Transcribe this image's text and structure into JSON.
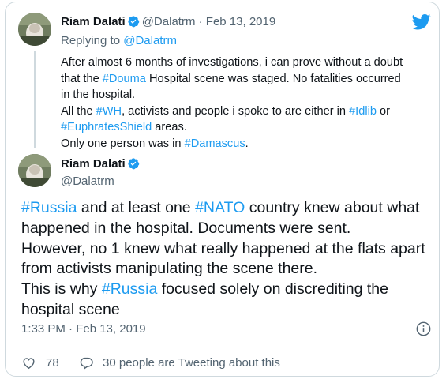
{
  "colors": {
    "accent": "#1d9bf0",
    "muted": "#536471",
    "border": "#cfd9de"
  },
  "parent_tweet": {
    "name": "Riam Dalati",
    "handle": "@Dalatrm",
    "separator": "·",
    "date": "Feb 13, 2019",
    "replying_prefix": "Replying to",
    "replying_to": "@Dalatrm",
    "lines": {
      "l1": "After almost 6 months of investigations, i can prove without a doubt",
      "l2a": "that the",
      "l2tag": "#Douma",
      "l2b": "Hospital scene was staged. No fatalities occurred",
      "l3": "in the hospital.",
      "l4a": "All the",
      "l4tag1": "#WH",
      "l4b": ", activists and people i spoke to are either in",
      "l4tag2": "#Idlib",
      "l4c": "or",
      "l5tag": "#EuphratesShield",
      "l5b": "areas.",
      "l6a": "Only one person was in",
      "l6tag": "#Damascus",
      "l6b": "."
    }
  },
  "main_tweet": {
    "name": "Riam Dalati",
    "handle": "@Dalatrm",
    "lines": {
      "l1tag1": "#Russia",
      "l1a": "and at least one",
      "l1tag2": "#NATO",
      "l1b": "country knew about what",
      "l2": "happened in the hospital. Documents were sent.",
      "l3": "However, no 1 knew what really happened at the flats apart",
      "l4": "from activists manipulating the scene there.",
      "l5a": "This is why",
      "l5tag": "#Russia",
      "l5b": "focused solely on discrediting the",
      "l6": "hospital scene"
    },
    "timestamp": "1:33 PM · Feb 13, 2019",
    "like_count": "78",
    "conversation_text": "30 people are Tweeting about this"
  },
  "icons": {
    "logo": "twitter-bird-icon",
    "verified": "verified-badge-icon",
    "info": "info-icon",
    "like": "heart-icon",
    "reply": "speech-bubble-icon"
  }
}
